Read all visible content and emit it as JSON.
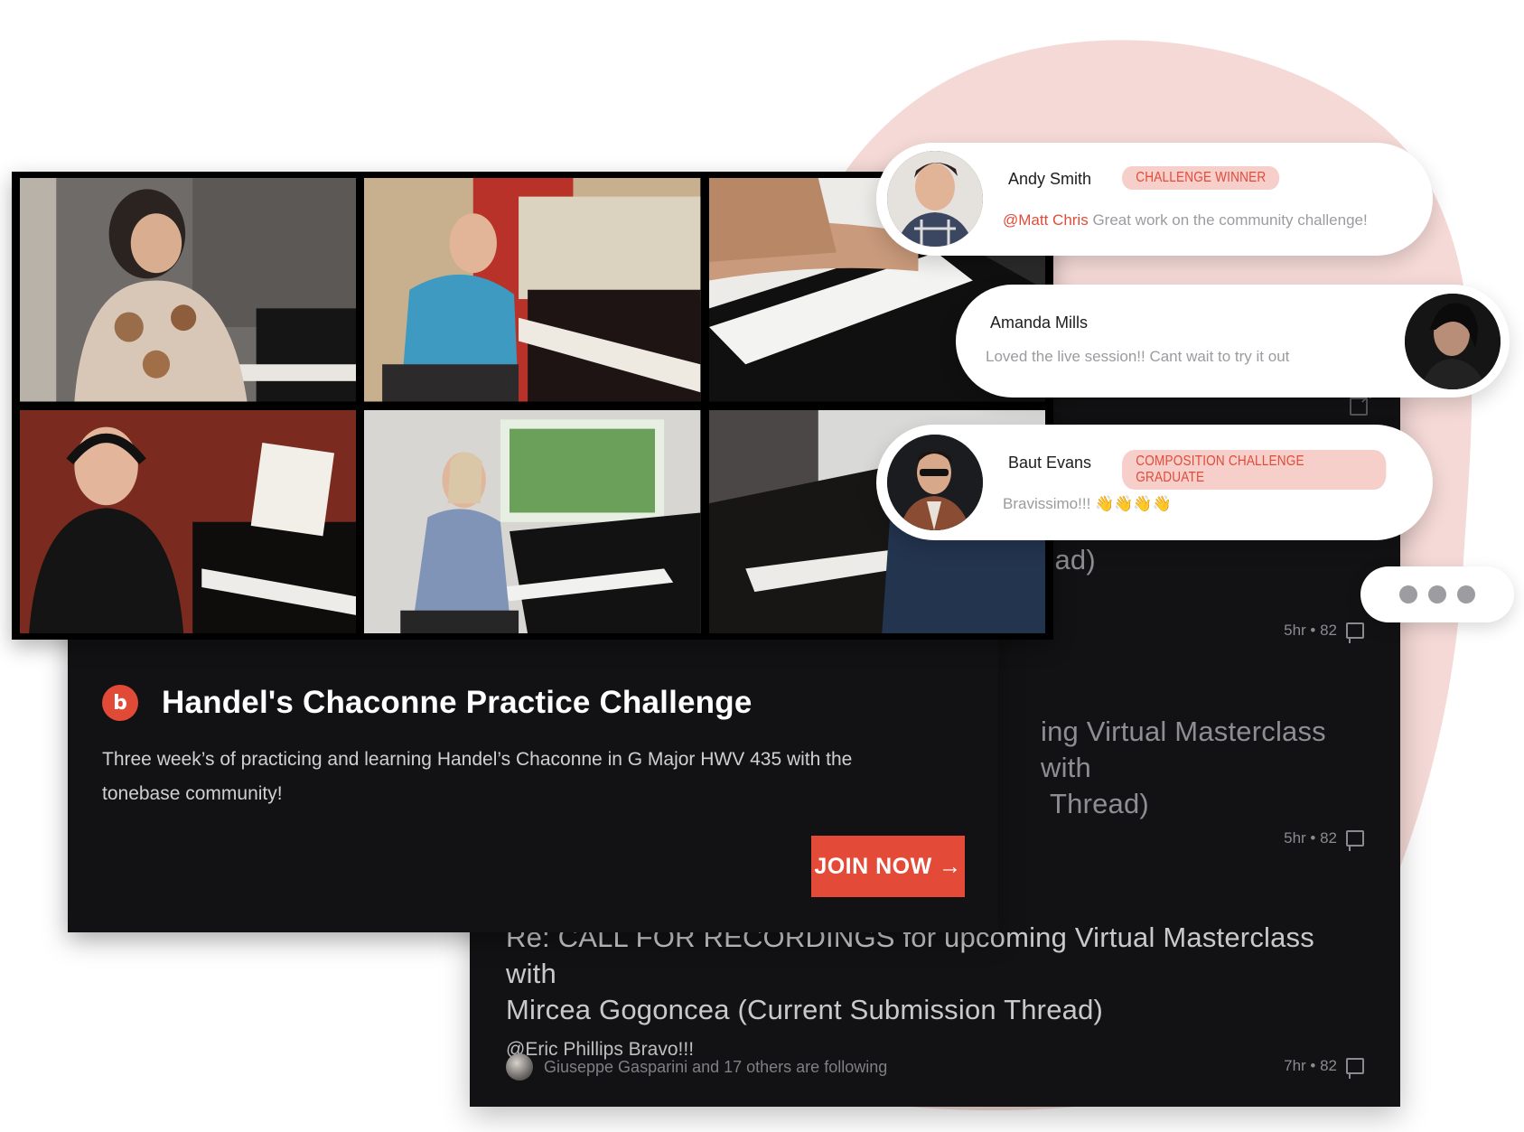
{
  "colors": {
    "accent": "#e34a37",
    "panel_dark": "#121214",
    "blob": "#f4d9d6",
    "badge_bg": "#f6cfcb"
  },
  "feed": {
    "partial_title_1": "ead)",
    "meta_1": "5hr • 82",
    "partial_title_2_line1": "ing Virtual Masterclass with",
    "partial_title_2_line2": "Thread)",
    "meta_2": "5hr • 82",
    "title_3_line1": "Re: CALL FOR RECORDINGS for upcoming Virtual Masterclass with",
    "title_3_line2": "Mircea Gogoncea (Current Submission Thread)",
    "reply_3": "@Eric Phillips Bravo!!!",
    "following_3": "Giuseppe Gasparini and 17 others are following",
    "meta_3": "7hr • 82"
  },
  "challenge": {
    "brand_icon_glyph": "b",
    "title": "Handel's Chaconne Practice Challenge",
    "description": "Three week’s of practicing and learning Handel’s Chaconne in G Major HWV 435 with the tonebase community!",
    "join_label": "JOIN NOW →"
  },
  "comments": [
    {
      "name": "Andy Smith",
      "badge": "CHALLENGE WINNER",
      "mention": "@Matt Chris",
      "text": " Great work on the community challenge!"
    },
    {
      "name": "Amanda Mills",
      "badge": "",
      "mention": "",
      "text": "Loved the live session!! Cant wait to try it out"
    },
    {
      "name": "Baut Evans",
      "badge": "COMPOSITION CHALLENGE GRADUATE",
      "mention": "",
      "text": "Bravissimo!!! 👋👋👋👋"
    }
  ],
  "video_tiles": [
    {
      "label": "pianist-woman-upright"
    },
    {
      "label": "pianist-man-blue-shirt"
    },
    {
      "label": "hands-on-keys"
    },
    {
      "label": "pianist-man-headphones"
    },
    {
      "label": "pianist-woman-grand"
    },
    {
      "label": "pianist-upright-dark-room"
    }
  ]
}
